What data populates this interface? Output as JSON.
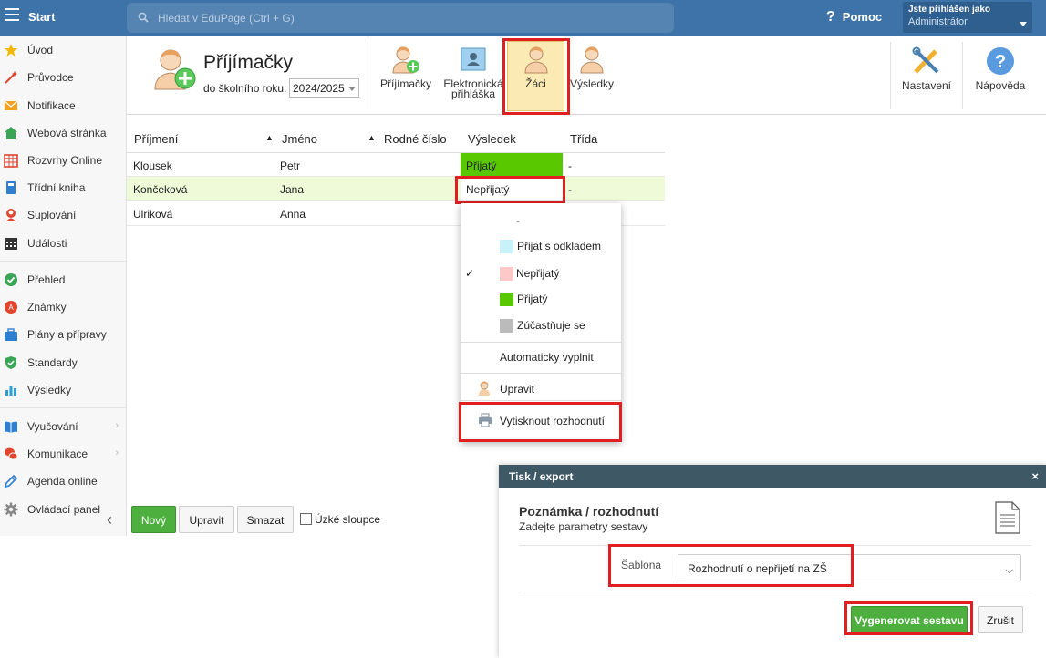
{
  "topbar": {
    "start_label": "Start",
    "search_placeholder": "Hledat v EduPage (Ctrl + G)",
    "help_label": "Pomoc",
    "user_line1": "Jste přihlášen jako",
    "user_line2": "Administrátor"
  },
  "sidebar": {
    "items": [
      {
        "label": "Úvod",
        "icon": "star-icon",
        "color": "#f5b800"
      },
      {
        "label": "Průvodce",
        "icon": "wand-icon",
        "color": "#e0452e"
      },
      {
        "label": "Notifikace",
        "icon": "envelope-icon",
        "color": "#f0a020"
      },
      {
        "label": "Webová stránka",
        "icon": "house-icon",
        "color": "#3aa655"
      },
      {
        "label": "Rozvrhy Online",
        "icon": "timetable-icon",
        "color": "#e0452e"
      },
      {
        "label": "Třídní kniha",
        "icon": "book-icon",
        "color": "#2f7fd0"
      },
      {
        "label": "Suplování",
        "icon": "person-icon",
        "color": "#e0452e"
      },
      {
        "label": "Události",
        "icon": "calendar-icon",
        "color": "#333333"
      },
      {
        "label": "Přehled",
        "icon": "check-circle-icon",
        "color": "#3aa655"
      },
      {
        "label": "Známky",
        "icon": "grades-icon",
        "color": "#e0452e"
      },
      {
        "label": "Plány a přípravy",
        "icon": "briefcase-icon",
        "color": "#2f7fd0"
      },
      {
        "label": "Standardy",
        "icon": "shield-icon",
        "color": "#3aa655"
      },
      {
        "label": "Výsledky",
        "icon": "bar-chart-icon",
        "color": "#2f9fd0"
      },
      {
        "label": "Vyučování",
        "icon": "open-book-icon",
        "color": "#2f7fd0"
      },
      {
        "label": "Komunikace",
        "icon": "chat-icon",
        "color": "#e0452e"
      },
      {
        "label": "Agenda online",
        "icon": "pen-icon",
        "color": "#2f7fd0"
      },
      {
        "label": "Ovládací panel",
        "icon": "gear-icon",
        "color": "#888888"
      }
    ]
  },
  "header": {
    "title": "Příjímačky",
    "year_label": "do školního roku:",
    "year_value": "2024/2025",
    "toolbar": {
      "prijimacky": "Příjímačky",
      "elektronicka_1": "Elektronická",
      "elektronicka_2": "přihláška",
      "zaci": "Žáci",
      "vysledky": "Výsledky",
      "nastaveni": "Nastavení",
      "napoveda": "Nápověda"
    }
  },
  "table": {
    "columns": [
      "Příjmení",
      "Jméno",
      "Rodné číslo",
      "Výsledek",
      "Třída"
    ],
    "rows": [
      {
        "prijmeni": "Klousek",
        "jmeno": "Petr",
        "vysledek": "Přijatý",
        "trida": "-",
        "status_color": "#5ac800"
      },
      {
        "prijmeni": "Končeková",
        "jmeno": "Jana",
        "vysledek": "Nepřijatý",
        "trida": "-",
        "status_color": "#ffffff"
      },
      {
        "prijmeni": "Ulriková",
        "jmeno": "Anna",
        "vysledek": "",
        "trida": "",
        "status_color": "#ffffff"
      }
    ],
    "selected_row_color": "#eefad8"
  },
  "context_menu": {
    "options": [
      {
        "label": "-",
        "color": ""
      },
      {
        "label": "Přijat s odkladem",
        "color": "#c8f2fa"
      },
      {
        "label": "Nepřijatý",
        "color": "#fcc8c8",
        "checked": true,
        "check": "✓"
      },
      {
        "label": "Přijatý",
        "color": "#5ac800"
      },
      {
        "label": "Zúčastňuje se",
        "color": "#bbbbbb"
      }
    ],
    "auto_fill": "Automaticky vyplnit",
    "edit": "Upravit",
    "print": "Vytisknout rozhodnutí"
  },
  "bottombar": {
    "new": "Nový",
    "edit": "Upravit",
    "delete": "Smazat",
    "narrow_cols": "Úzké sloupce"
  },
  "dialog": {
    "header": "Tisk / export",
    "close": "×",
    "title": "Poznámka / rozhodnutí",
    "subtitle": "Zadejte parametry sestavy",
    "template_label": "Šablona",
    "template_value": "Rozhodnutí o nepřijetí na ZŠ",
    "generate": "Vygenerovat sestavu",
    "cancel": "Zrušit"
  }
}
